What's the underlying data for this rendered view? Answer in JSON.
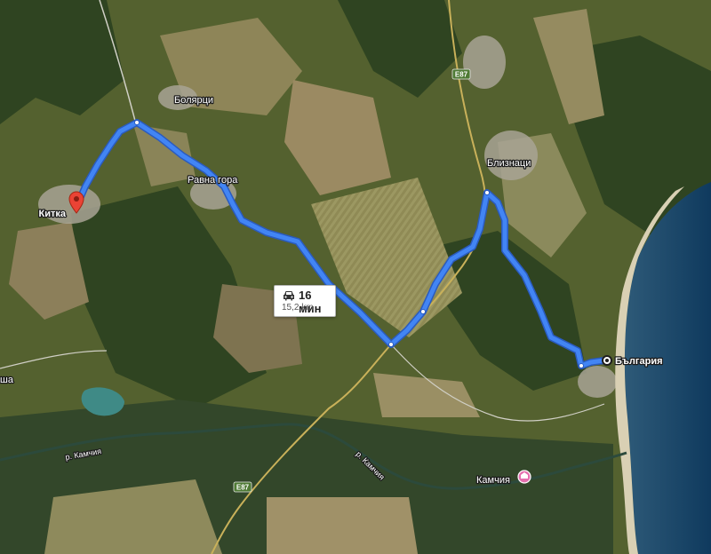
{
  "map": {
    "places": {
      "start": "Китка",
      "end": "България",
      "village_boliartsi": "Болярци",
      "village_ravna_gora": "Равна гора",
      "village_bliznatsi": "Близнаци",
      "river_left": "р. Камчия",
      "river_center": "р. Камчия",
      "resort": "Камчия",
      "edge_partial": "ша"
    },
    "roads": {
      "e87_north": "E87",
      "e87_south": "E87"
    },
    "route": {
      "duration": "16 мин",
      "distance": "15,2 km",
      "mode_icon": "car-icon",
      "color": "#4285f4"
    },
    "markers": {
      "start_icon": "location-pin-icon",
      "end_icon": "destination-dot-icon",
      "resort_icon": "resort-pin-icon",
      "pin_color": "#ea4335",
      "resort_color": "#e56fae"
    }
  }
}
